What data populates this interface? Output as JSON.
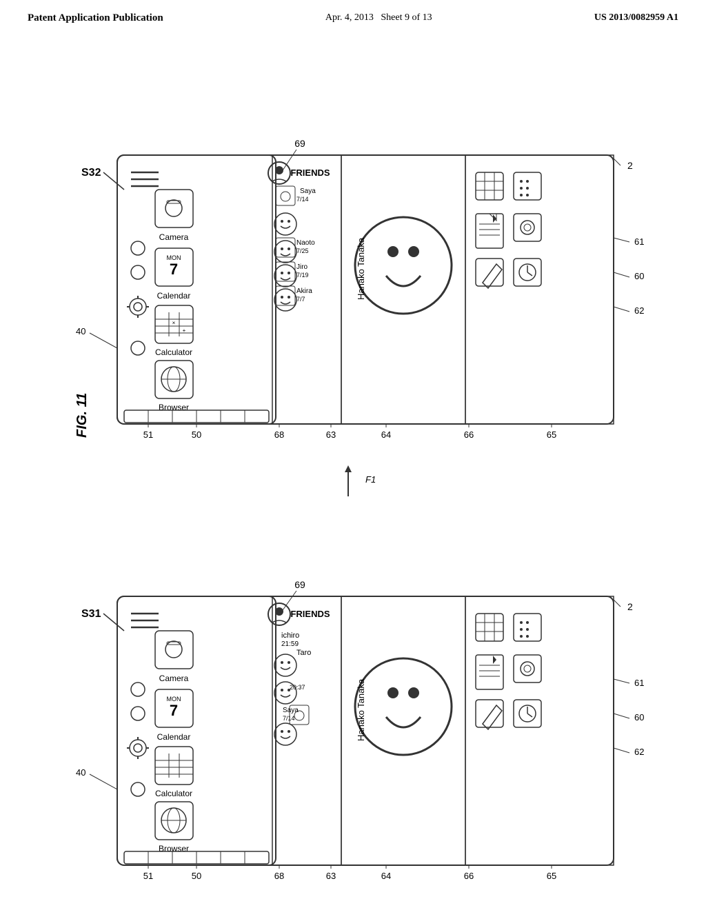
{
  "header": {
    "left": "Patent Application Publication",
    "center_date": "Apr. 4, 2013",
    "center_sheet": "Sheet 9 of 13",
    "right": "US 2013/0082959 A1"
  },
  "figure": {
    "label": "FIG. 11"
  },
  "diagrams": {
    "top": {
      "state_label": "S32",
      "friends_label": "FRIENDS",
      "contacts": [
        {
          "name": "Saya",
          "date": "7/14",
          "icon": "camera"
        },
        {
          "name": "Naoto",
          "date": "7/25",
          "icon": "book"
        },
        {
          "name": "Jiro",
          "date": "7/19",
          "icon": "book"
        },
        {
          "name": "Akira",
          "date": "7/7",
          "icon": "book"
        }
      ],
      "selected_contact": "Hanako Tanaka",
      "apps": [
        "Camera",
        "Calendar",
        "Calculator",
        "Browser"
      ],
      "ref_numbers": [
        "40",
        "50",
        "51",
        "60",
        "61",
        "62",
        "63",
        "64",
        "65",
        "66",
        "68",
        "69",
        "2"
      ]
    },
    "bottom": {
      "state_label": "S31",
      "friends_label": "FRIENDS",
      "contacts": [
        {
          "name": "ichiro",
          "time": "21:59"
        },
        {
          "name": "Taro",
          "time": ""
        },
        {
          "name": "Saya",
          "date": "7/14",
          "icon": "camera"
        }
      ],
      "selected_contact": "Hanako Tanaka",
      "apps": [
        "Camera",
        "Calendar",
        "Calculator",
        "Browser"
      ],
      "ref_numbers": [
        "40",
        "50",
        "51",
        "60",
        "61",
        "62",
        "63",
        "64",
        "65",
        "66",
        "68",
        "69",
        "2"
      ],
      "arrow_label": "F1"
    }
  }
}
